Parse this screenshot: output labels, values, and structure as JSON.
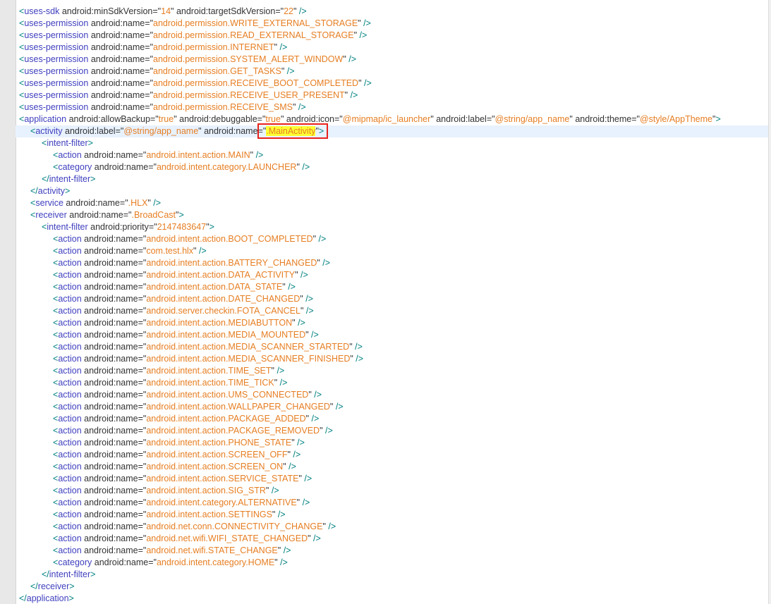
{
  "editor": {
    "highlight_color": "#ffff33",
    "annotation_color": "#e8211c",
    "tag_color": "#3f3fbf",
    "value_color": "#e67e22",
    "lines": [
      {
        "indent": 0,
        "type": "el",
        "tag": "uses-sdk",
        "attrs": [
          [
            "android:minSdkVersion",
            "14"
          ],
          [
            "android:targetSdkVersion",
            "22"
          ]
        ],
        "end": " />"
      },
      {
        "indent": 0,
        "type": "el",
        "tag": "uses-permission",
        "attrs": [
          [
            "android:name",
            "android.permission.WRITE_EXTERNAL_STORAGE"
          ]
        ],
        "end": " />"
      },
      {
        "indent": 0,
        "type": "el",
        "tag": "uses-permission",
        "attrs": [
          [
            "android:name",
            "android.permission.READ_EXTERNAL_STORAGE"
          ]
        ],
        "end": " />"
      },
      {
        "indent": 0,
        "type": "el",
        "tag": "uses-permission",
        "attrs": [
          [
            "android:name",
            "android.permission.INTERNET"
          ]
        ],
        "end": " />"
      },
      {
        "indent": 0,
        "type": "el",
        "tag": "uses-permission",
        "attrs": [
          [
            "android:name",
            "android.permission.SYSTEM_ALERT_WINDOW"
          ]
        ],
        "end": " />"
      },
      {
        "indent": 0,
        "type": "el",
        "tag": "uses-permission",
        "attrs": [
          [
            "android:name",
            "android.permission.GET_TASKS"
          ]
        ],
        "end": " />"
      },
      {
        "indent": 0,
        "type": "el",
        "tag": "uses-permission",
        "attrs": [
          [
            "android:name",
            "android.permission.RECEIVE_BOOT_COMPLETED"
          ]
        ],
        "end": " />"
      },
      {
        "indent": 0,
        "type": "el",
        "tag": "uses-permission",
        "attrs": [
          [
            "android:name",
            "android.permission.RECEIVE_USER_PRESENT"
          ]
        ],
        "end": " />"
      },
      {
        "indent": 0,
        "type": "el",
        "tag": "uses-permission",
        "attrs": [
          [
            "android:name",
            "android.permission.RECEIVE_SMS"
          ]
        ],
        "end": " />"
      },
      {
        "indent": 0,
        "type": "el",
        "tag": "application",
        "attrs": [
          [
            "android:allowBackup",
            "true"
          ],
          [
            "android:debuggable",
            "true"
          ],
          [
            "android:icon",
            "@mipmap/ic_launcher"
          ],
          [
            "android:label",
            "@string/app_name"
          ],
          [
            "android:theme",
            "@style/AppTheme"
          ]
        ],
        "end": ">"
      },
      {
        "indent": 1,
        "type": "el",
        "tag": "activity",
        "attrs": [
          [
            "android:label",
            "@string/app_name"
          ],
          [
            "android:name",
            ".MainActivity"
          ]
        ],
        "end": ">",
        "current": true,
        "highlight_attr": 1
      },
      {
        "indent": 2,
        "type": "el",
        "tag": "intent-filter",
        "attrs": [],
        "end": ">"
      },
      {
        "indent": 3,
        "type": "el",
        "tag": "action",
        "attrs": [
          [
            "android:name",
            "android.intent.action.MAIN"
          ]
        ],
        "end": " />"
      },
      {
        "indent": 3,
        "type": "el",
        "tag": "category",
        "attrs": [
          [
            "android:name",
            "android.intent.category.LAUNCHER"
          ]
        ],
        "end": " />"
      },
      {
        "indent": 2,
        "type": "close",
        "tag": "intent-filter"
      },
      {
        "indent": 1,
        "type": "close",
        "tag": "activity"
      },
      {
        "indent": 1,
        "type": "el",
        "tag": "service",
        "attrs": [
          [
            "android:name",
            ".HLX"
          ]
        ],
        "end": " />"
      },
      {
        "indent": 1,
        "type": "el",
        "tag": "receiver",
        "attrs": [
          [
            "android:name",
            ".BroadCast"
          ]
        ],
        "end": ">"
      },
      {
        "indent": 2,
        "type": "el",
        "tag": "intent-filter",
        "attrs": [
          [
            "android:priority",
            "2147483647"
          ]
        ],
        "end": ">"
      },
      {
        "indent": 3,
        "type": "el",
        "tag": "action",
        "attrs": [
          [
            "android:name",
            "android.intent.action.BOOT_COMPLETED"
          ]
        ],
        "end": " />"
      },
      {
        "indent": 3,
        "type": "el",
        "tag": "action",
        "attrs": [
          [
            "android:name",
            "com.test.hlx"
          ]
        ],
        "end": " />"
      },
      {
        "indent": 3,
        "type": "el",
        "tag": "action",
        "attrs": [
          [
            "android:name",
            "android.intent.action.BATTERY_CHANGED"
          ]
        ],
        "end": " />"
      },
      {
        "indent": 3,
        "type": "el",
        "tag": "action",
        "attrs": [
          [
            "android:name",
            "android.intent.action.DATA_ACTIVITY"
          ]
        ],
        "end": " />"
      },
      {
        "indent": 3,
        "type": "el",
        "tag": "action",
        "attrs": [
          [
            "android:name",
            "android.intent.action.DATA_STATE"
          ]
        ],
        "end": " />"
      },
      {
        "indent": 3,
        "type": "el",
        "tag": "action",
        "attrs": [
          [
            "android:name",
            "android.intent.action.DATE_CHANGED"
          ]
        ],
        "end": " />"
      },
      {
        "indent": 3,
        "type": "el",
        "tag": "action",
        "attrs": [
          [
            "android:name",
            "android.server.checkin.FOTA_CANCEL"
          ]
        ],
        "end": " />"
      },
      {
        "indent": 3,
        "type": "el",
        "tag": "action",
        "attrs": [
          [
            "android:name",
            "android.intent.action.MEDIABUTTON"
          ]
        ],
        "end": " />"
      },
      {
        "indent": 3,
        "type": "el",
        "tag": "action",
        "attrs": [
          [
            "android:name",
            "android.intent.action.MEDIA_MOUNTED"
          ]
        ],
        "end": " />"
      },
      {
        "indent": 3,
        "type": "el",
        "tag": "action",
        "attrs": [
          [
            "android:name",
            "android.intent.action.MEDIA_SCANNER_STARTED"
          ]
        ],
        "end": " />"
      },
      {
        "indent": 3,
        "type": "el",
        "tag": "action",
        "attrs": [
          [
            "android:name",
            "android.intent.action.MEDIA_SCANNER_FINISHED"
          ]
        ],
        "end": " />"
      },
      {
        "indent": 3,
        "type": "el",
        "tag": "action",
        "attrs": [
          [
            "android:name",
            "android.intent.action.TIME_SET"
          ]
        ],
        "end": " />"
      },
      {
        "indent": 3,
        "type": "el",
        "tag": "action",
        "attrs": [
          [
            "android:name",
            "android.intent.action.TIME_TICK"
          ]
        ],
        "end": " />"
      },
      {
        "indent": 3,
        "type": "el",
        "tag": "action",
        "attrs": [
          [
            "android:name",
            "android.intent.action.UMS_CONNECTED"
          ]
        ],
        "end": " />"
      },
      {
        "indent": 3,
        "type": "el",
        "tag": "action",
        "attrs": [
          [
            "android:name",
            "android.intent.action.WALLPAPER_CHANGED"
          ]
        ],
        "end": " />"
      },
      {
        "indent": 3,
        "type": "el",
        "tag": "action",
        "attrs": [
          [
            "android:name",
            "android.intent.action.PACKAGE_ADDED"
          ]
        ],
        "end": " />"
      },
      {
        "indent": 3,
        "type": "el",
        "tag": "action",
        "attrs": [
          [
            "android:name",
            "android.intent.action.PACKAGE_REMOVED"
          ]
        ],
        "end": " />"
      },
      {
        "indent": 3,
        "type": "el",
        "tag": "action",
        "attrs": [
          [
            "android:name",
            "android.intent.action.PHONE_STATE"
          ]
        ],
        "end": " />"
      },
      {
        "indent": 3,
        "type": "el",
        "tag": "action",
        "attrs": [
          [
            "android:name",
            "android.intent.action.SCREEN_OFF"
          ]
        ],
        "end": " />"
      },
      {
        "indent": 3,
        "type": "el",
        "tag": "action",
        "attrs": [
          [
            "android:name",
            "android.intent.action.SCREEN_ON"
          ]
        ],
        "end": " />"
      },
      {
        "indent": 3,
        "type": "el",
        "tag": "action",
        "attrs": [
          [
            "android:name",
            "android.intent.action.SERVICE_STATE"
          ]
        ],
        "end": " />"
      },
      {
        "indent": 3,
        "type": "el",
        "tag": "action",
        "attrs": [
          [
            "android:name",
            "android.intent.action.SIG_STR"
          ]
        ],
        "end": " />"
      },
      {
        "indent": 3,
        "type": "el",
        "tag": "action",
        "attrs": [
          [
            "android:name",
            "android.intent.category.ALTERNATIVE"
          ]
        ],
        "end": " />"
      },
      {
        "indent": 3,
        "type": "el",
        "tag": "action",
        "attrs": [
          [
            "android:name",
            "android.intent.action.SETTINGS"
          ]
        ],
        "end": " />"
      },
      {
        "indent": 3,
        "type": "el",
        "tag": "action",
        "attrs": [
          [
            "android:name",
            "android.net.conn.CONNECTIVITY_CHANGE"
          ]
        ],
        "end": " />"
      },
      {
        "indent": 3,
        "type": "el",
        "tag": "action",
        "attrs": [
          [
            "android:name",
            "android.net.wifi.WIFI_STATE_CHANGED"
          ]
        ],
        "end": " />"
      },
      {
        "indent": 3,
        "type": "el",
        "tag": "action",
        "attrs": [
          [
            "android:name",
            "android.net.wifi.STATE_CHANGE"
          ]
        ],
        "end": " />"
      },
      {
        "indent": 3,
        "type": "el",
        "tag": "category",
        "attrs": [
          [
            "android:name",
            "android.intent.category.HOME"
          ]
        ],
        "end": " />"
      },
      {
        "indent": 2,
        "type": "close",
        "tag": "intent-filter"
      },
      {
        "indent": 1,
        "type": "close",
        "tag": "receiver"
      },
      {
        "indent": 0,
        "type": "close",
        "tag": "application"
      }
    ]
  }
}
